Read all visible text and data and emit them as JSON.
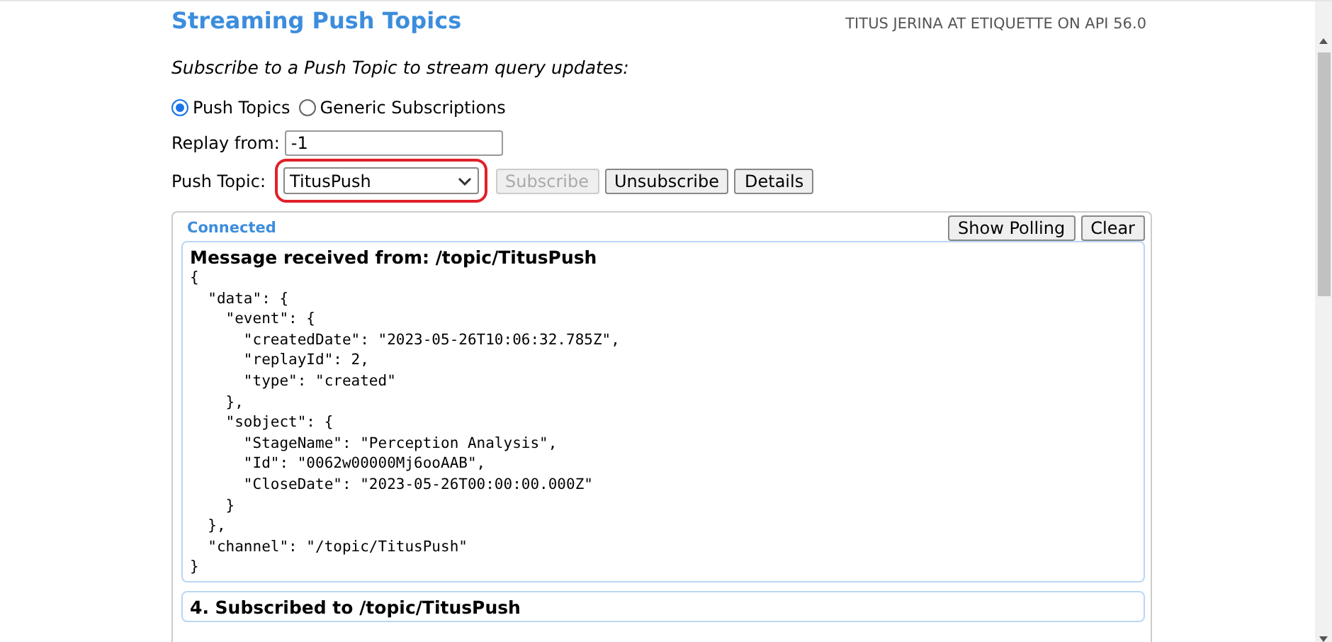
{
  "header": {
    "title": "Streaming Push Topics",
    "user_info": "TITUS JERINA AT ETIQUETTE ON API 56.0"
  },
  "intro": "Subscribe to a Push Topic to stream query updates:",
  "modes": [
    {
      "label": "Push Topics",
      "selected": true
    },
    {
      "label": "Generic Subscriptions",
      "selected": false
    }
  ],
  "replay": {
    "label": "Replay from:",
    "value": "-1"
  },
  "push_topic": {
    "label": "Push Topic:",
    "value": "TitusPush",
    "highlighted": true
  },
  "actions": [
    {
      "label": "Subscribe",
      "disabled": true
    },
    {
      "label": "Unsubscribe",
      "disabled": false
    },
    {
      "label": "Details",
      "disabled": false
    }
  ],
  "panel": {
    "status": "Connected",
    "buttons": [
      "Show Polling",
      "Clear"
    ],
    "messages": [
      {
        "title": "Message received from: /topic/TitusPush",
        "lines": [
          "{",
          "  \"data\": {",
          "    \"event\": {",
          "      \"createdDate\": \"2023-05-26T10:06:32.785Z\",",
          "      \"replayId\": 2,",
          "      \"type\": \"created\"",
          "    },",
          "    \"sobject\": {",
          "      \"StageName\": \"Perception Analysis\",",
          "      \"Id\": \"0062w00000Mj6ooAAB\",",
          "      \"CloseDate\": \"2023-05-26T00:00:00.000Z\"",
          "    }",
          "  },",
          "  \"channel\": \"/topic/TitusPush\"",
          "}"
        ]
      },
      {
        "title": "4. Subscribed to /topic/TitusPush"
      }
    ]
  }
}
